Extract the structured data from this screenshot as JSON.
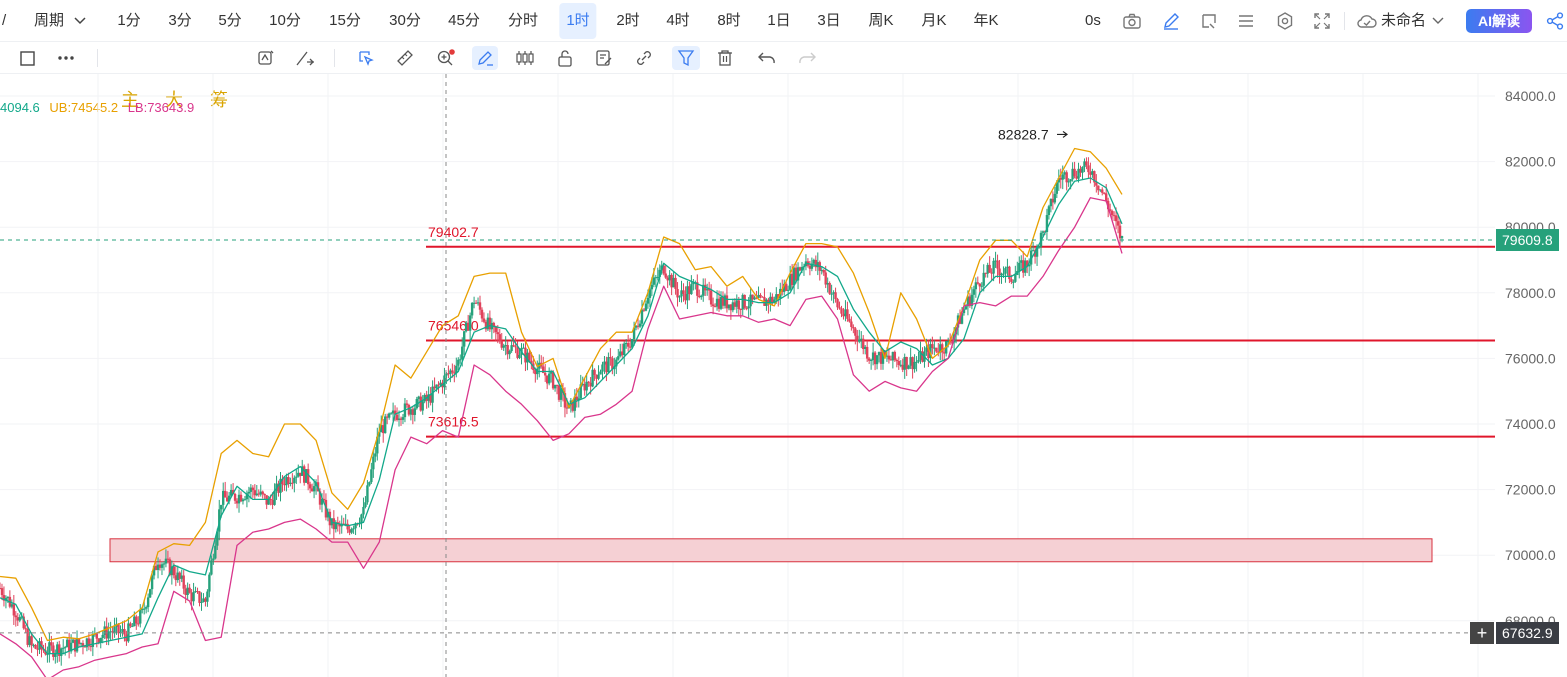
{
  "toolbar": {
    "cursor_glyph": "/",
    "period_label": "周期",
    "timeframes": [
      "1分",
      "3分",
      "5分",
      "10分",
      "15分",
      "30分",
      "45分",
      "分时",
      "1时",
      "2时",
      "4时",
      "8时",
      "1日",
      "3日",
      "周K",
      "月K",
      "年K"
    ],
    "active_timeframe": "1时",
    "countdown": "0s",
    "layout_name": "未命名",
    "ai_button": "AI解读"
  },
  "indicator_toolbar": {
    "buttons": [
      "主",
      "大",
      "筹"
    ],
    "icons": [
      "square-icon",
      "more-icon",
      "rotate-icon",
      "pen-swap-icon",
      "draw-cursor-icon",
      "ruler-icon",
      "zoom-icon",
      "magnet-pen-icon",
      "candles-icon",
      "lock-icon",
      "note-icon",
      "link-icon",
      "filter-icon",
      "trash-icon",
      "undo-icon",
      "redo-icon"
    ]
  },
  "legend": {
    "mid": "4094.6",
    "ub_label": "UB:74545.2",
    "lb_label": "LB:73643.9",
    "mid_color": "#12a88a",
    "ub_color": "#e8a000",
    "lb_color": "#d9368c"
  },
  "chart_data": {
    "type": "line",
    "ylim": [
      66000,
      85000
    ],
    "y_ticks": [
      "84000.0",
      "82000.0",
      "80000.0",
      "78000.0",
      "76000.0",
      "74000.0",
      "72000.0",
      "70000.0",
      "68000.0"
    ],
    "y_tick_values": [
      84000,
      82000,
      80000,
      78000,
      76000,
      74000,
      72000,
      70000,
      68000
    ],
    "current_price": {
      "label": "79609.8",
      "value": 79609.8,
      "color": "#26a17b"
    },
    "crosshair_price": {
      "label": "67632.9",
      "value": 67632.9
    },
    "peak": {
      "label": "82828.7",
      "value": 82828.7
    },
    "levels": [
      {
        "label": "79402.7",
        "value": 79402.7
      },
      {
        "label": "76546.0",
        "value": 76546.0
      },
      {
        "label": "73616.5",
        "value": 73616.5
      }
    ],
    "zone": {
      "low": 69800,
      "high": 70500
    },
    "colors": {
      "up": "#26a17b",
      "down": "#e0425b",
      "level": "#e0162b",
      "zone_fill": "#f5d0d4",
      "zone_stroke": "#d8323f",
      "mid": "#12a88a",
      "ub": "#e8a000",
      "lb": "#d9368c"
    },
    "series": [
      {
        "name": "UB",
        "values": [
          69350,
          69300,
          68400,
          67400,
          67500,
          67450,
          67600,
          67800,
          68000,
          68400,
          70100,
          70350,
          70300,
          71000,
          73100,
          73500,
          73100,
          73000,
          74000,
          74000,
          73500,
          71900,
          71400,
          72200,
          73800,
          75800,
          75400,
          76200,
          77000,
          77300,
          78500,
          78600,
          78600,
          76800,
          75750,
          76000,
          74500,
          75400,
          76300,
          76800,
          76800,
          78000,
          79700,
          79500,
          78700,
          78800,
          78200,
          78500,
          77800,
          77600,
          78600,
          79500,
          79500,
          79400,
          78600,
          77400,
          76000,
          78000,
          77200,
          76000,
          76400,
          77600,
          79000,
          79600,
          79600,
          79100,
          80600,
          81500,
          82400,
          82300,
          81800,
          81000
        ]
      },
      {
        "name": "MID",
        "values": [
          68700,
          68500,
          67600,
          67000,
          67000,
          67200,
          67300,
          67400,
          67500,
          67600,
          68700,
          69700,
          69500,
          69400,
          71200,
          72100,
          71700,
          71700,
          72400,
          72700,
          72200,
          71000,
          70900,
          71000,
          72300,
          74300,
          74500,
          74800,
          75200,
          75600,
          76800,
          77000,
          76900,
          76200,
          75600,
          75600,
          74600,
          74800,
          75300,
          75800,
          76300,
          77300,
          78900,
          78500,
          78300,
          78100,
          77800,
          77800,
          77700,
          77700,
          78000,
          78900,
          78800,
          78500,
          77500,
          76800,
          76200,
          76500,
          76300,
          75800,
          76000,
          76600,
          78000,
          78500,
          78500,
          78800,
          79700,
          80700,
          81400,
          81500,
          81200,
          80100
        ]
      },
      {
        "name": "LB",
        "values": [
          67600,
          67300,
          66900,
          66200,
          66500,
          66600,
          66800,
          66900,
          67000,
          67200,
          67300,
          68900,
          68600,
          67400,
          67500,
          70300,
          70700,
          70800,
          71000,
          71100,
          70800,
          70400,
          70400,
          69600,
          70400,
          72600,
          73600,
          73400,
          73800,
          73600,
          75800,
          75500,
          75000,
          74600,
          74100,
          73500,
          73700,
          74200,
          74300,
          74600,
          75000,
          76900,
          78200,
          77200,
          77300,
          77400,
          77300,
          77300,
          77100,
          77200,
          77000,
          77800,
          77900,
          77200,
          75500,
          75000,
          75300,
          75100,
          75000,
          75600,
          76000,
          77600,
          77700,
          77600,
          77900,
          77900,
          78500,
          79300,
          80000,
          80900,
          80800,
          79200
        ]
      },
      {
        "name": "Price",
        "values": [
          69000,
          68300,
          67200,
          67100,
          67200,
          67300,
          67500,
          67700,
          67600,
          68200,
          69900,
          69500,
          68800,
          68600,
          71700,
          71800,
          72000,
          71600,
          72300,
          72600,
          72000,
          70900,
          70800,
          71300,
          73800,
          74300,
          74500,
          74700,
          75300,
          75900,
          77800,
          76900,
          76400,
          76200,
          75700,
          75300,
          74400,
          75200,
          75700,
          75900,
          76600,
          78000,
          78800,
          77900,
          78200,
          77800,
          77700,
          77700,
          77700,
          77800,
          78400,
          79000,
          78700,
          77600,
          76900,
          76100,
          76000,
          75900,
          75900,
          76300,
          76400,
          77500,
          78400,
          78800,
          78500,
          78900,
          79800,
          81500,
          81700,
          81800,
          80800,
          79600
        ]
      }
    ]
  }
}
